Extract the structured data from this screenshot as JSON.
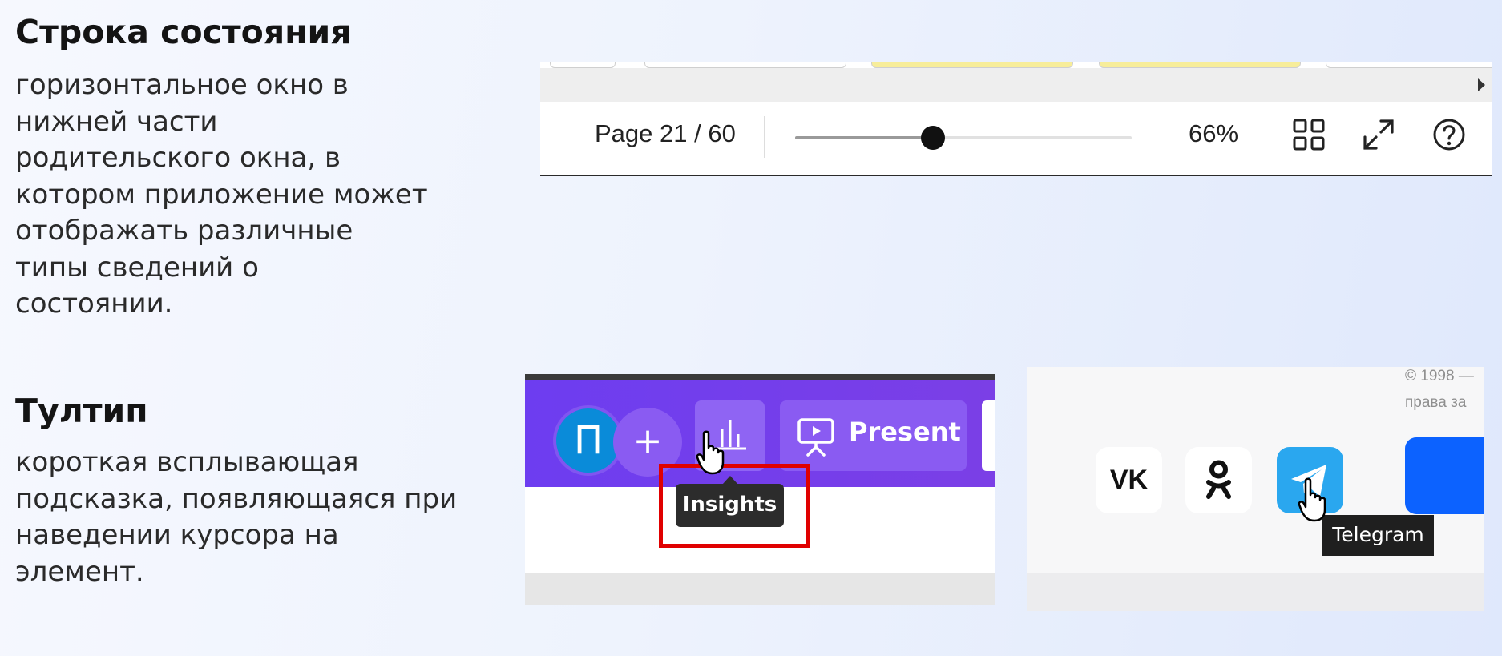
{
  "left": {
    "status_bar": {
      "title": "Строка состояния",
      "description": "горизонтальное окно в\nнижней части\nродительского окна, в\nкотором приложение может\nотображать различные\nтипы сведений о\nсостоянии."
    },
    "tooltip": {
      "title": "Тултип",
      "description": "короткая всплывающая\nподсказка, появляющаяся при\nнаведении курсора на\nэлемент."
    }
  },
  "statusbar_screenshot": {
    "page_label": "Page 21 / 60",
    "zoom_label": "66%",
    "zoom_level_fraction": 0.41,
    "icons": [
      "grid-view-icon",
      "fullscreen-icon",
      "help-icon"
    ]
  },
  "canva_screenshot": {
    "avatar_letter": "П",
    "plus_label": "+",
    "present_label": "Present",
    "tooltip_text": "Insights",
    "colors": {
      "toolbar": "#7b3fe6",
      "avatar": "#0a8bd9",
      "highlight": "#e00000"
    }
  },
  "social_screenshot": {
    "copyright_text": "© 1998 —\nправа за",
    "vk_label": "VK",
    "tooltip_text": "Telegram",
    "colors": {
      "telegram": "#2aa7ef",
      "blue_button": "#0c62ff"
    }
  }
}
